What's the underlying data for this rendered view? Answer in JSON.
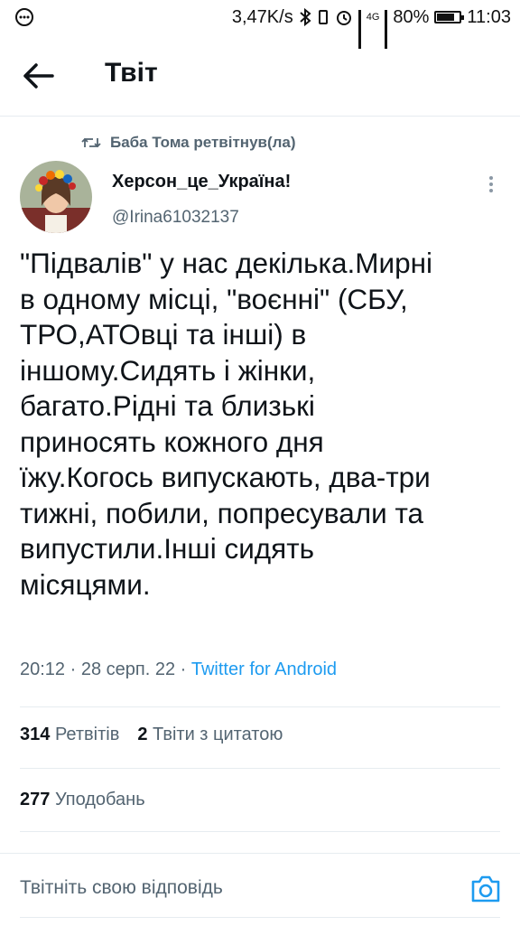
{
  "status_bar": {
    "speed": "3,47K/s",
    "battery": "80%",
    "battery_level": 0.8,
    "time": "11:03",
    "network": "4G"
  },
  "header": {
    "title": "Твіт"
  },
  "retweet": {
    "text": "Баба Тома ретвітнув(ла)"
  },
  "author": {
    "name": "Херсон_це_Україна!",
    "handle": "@Irina61032137"
  },
  "tweet": {
    "lines": [
      "\"Підвалів\" у нас декілька.Мирні",
      "в одному місці, \"воєнні\" (СБУ,",
      "ТРО,АТОвці та інші) в",
      "іншому.Сидять і жінки,",
      "багато.Рідні та близькі",
      "приносять кожного дня",
      "їжу.Когось випускають, два-три",
      "тижні, побили, попресували та",
      "випустили.Інші сидять",
      "місяцями."
    ],
    "time": "20:12",
    "date": "28 серп. 22",
    "source": "Twitter for Android",
    "separator": " · "
  },
  "stats": {
    "retweets": "314",
    "retweets_label": "Ретвітів",
    "quotes": "2",
    "quotes_label": "Твіти з цитатою",
    "likes": "277",
    "likes_label": "Уподобань"
  },
  "reply": {
    "placeholder": "Твітніть свою відповідь"
  },
  "colors": {
    "accent": "#1d9bf0",
    "secondary_text": "#536471",
    "divider": "#e6ecf0"
  }
}
